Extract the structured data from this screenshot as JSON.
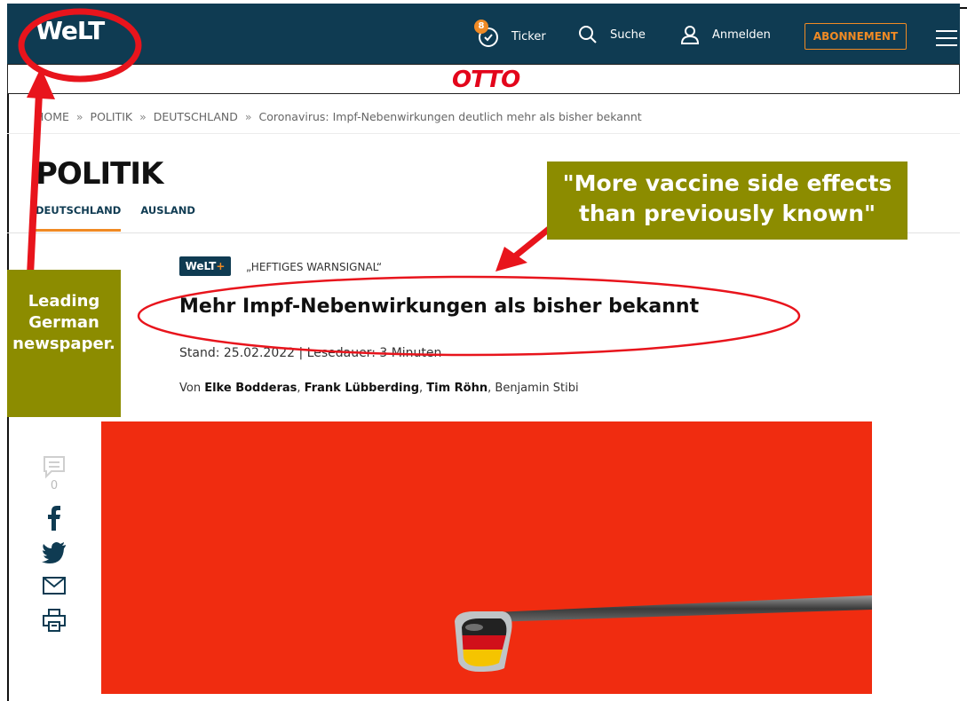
{
  "header": {
    "logo": "WeLT",
    "ticker": {
      "badge": "8",
      "label": "Ticker"
    },
    "search_label": "Suche",
    "login_label": "Anmelden",
    "subscribe_label": "ABONNEMENT"
  },
  "ad": {
    "brand": "OTTO"
  },
  "breadcrumb": [
    "HOME",
    "POLITIK",
    "DEUTSCHLAND",
    "Coronavirus: Impf-Nebenwirkungen deutlich mehr als bisher bekannt"
  ],
  "breadcrumb_separator": "»",
  "section": {
    "title": "POLITIK",
    "tabs": [
      {
        "label": "DEUTSCHLAND",
        "active": true
      },
      {
        "label": "AUSLAND",
        "active": false
      }
    ]
  },
  "article": {
    "badge_main": "WeLT",
    "badge_plus": "+",
    "kicker": "„HEFTIGES WARNSIGNAL“",
    "headline": "Mehr Impf-Nebenwirkungen als bisher bekannt",
    "stand": "Stand: 25.02.2022 | Lesedauer: 3 Minuten",
    "by": "Von",
    "authors": [
      "Elke Bodderas",
      "Frank Lübberding",
      "Tim Röhn",
      "Benjamin Stibi"
    ]
  },
  "share": {
    "comment_count": "0",
    "icons": [
      "comment-icon",
      "facebook-icon",
      "twitter-icon",
      "mail-icon",
      "print-icon"
    ]
  },
  "annotations": {
    "left_box": [
      "Leading",
      "German",
      "newspaper."
    ],
    "right_box": [
      "\"More vaccine side effects",
      "than previously known\""
    ]
  },
  "colors": {
    "nav_bg": "#0f3b52",
    "accent": "#f08a24",
    "annotation_red": "#e8141c",
    "annotation_box": "#8c8c00",
    "hero_bg": "#f02c10"
  }
}
